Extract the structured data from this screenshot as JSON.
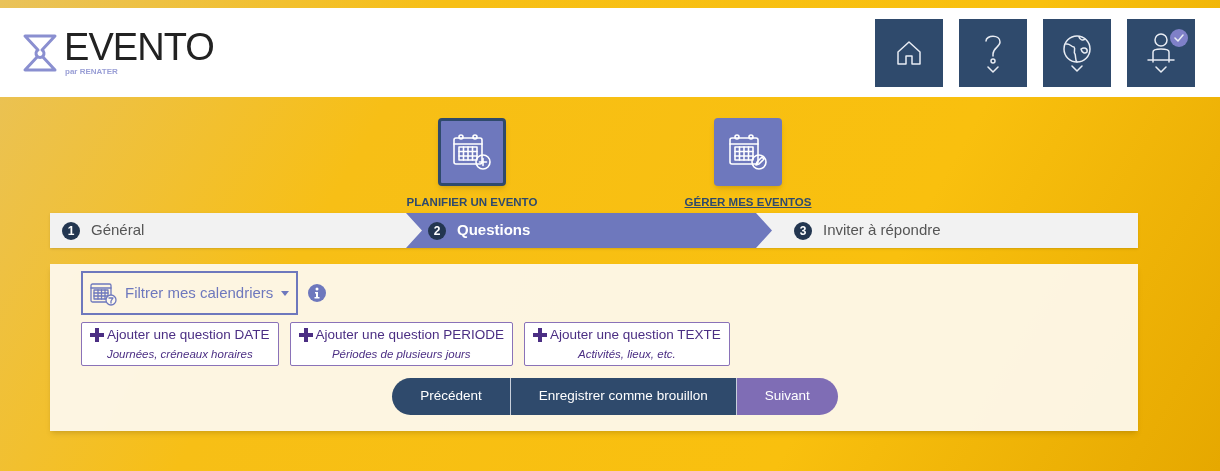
{
  "logo": {
    "name": "EVENTO",
    "tagline": "par RENATER"
  },
  "nav": [
    {
      "kind": "home",
      "dropdown": false,
      "checked": false
    },
    {
      "kind": "help",
      "dropdown": true,
      "checked": false
    },
    {
      "kind": "language",
      "dropdown": true,
      "checked": false
    },
    {
      "kind": "user",
      "dropdown": true,
      "checked": true
    }
  ],
  "modes": [
    {
      "kind": "plan",
      "label": "PLANIFIER UN EVENTO",
      "selected": true
    },
    {
      "kind": "manage",
      "label": "GÉRER MES EVENTOS",
      "selected": false
    }
  ],
  "steps": [
    {
      "number": "1",
      "label": "Général",
      "selected": false
    },
    {
      "number": "2",
      "label": "Questions",
      "selected": true
    },
    {
      "number": "3",
      "label": "Inviter à répondre",
      "selected": false
    }
  ],
  "filter": {
    "label": "Filtrer mes calendriers"
  },
  "question_buttons": [
    {
      "title": "Ajouter une question DATE",
      "subtitle": "Journées, créneaux horaires"
    },
    {
      "title": "Ajouter une question PERIODE",
      "subtitle": "Périodes de plusieurs jours"
    },
    {
      "title": "Ajouter une question TEXTE",
      "subtitle": "Activités, lieux, etc."
    }
  ],
  "actions": [
    {
      "kind": "secondary",
      "label": "Précédent"
    },
    {
      "kind": "secondary",
      "label": "Enregistrer comme brouillon"
    },
    {
      "kind": "primary",
      "label": "Suivant"
    }
  ]
}
